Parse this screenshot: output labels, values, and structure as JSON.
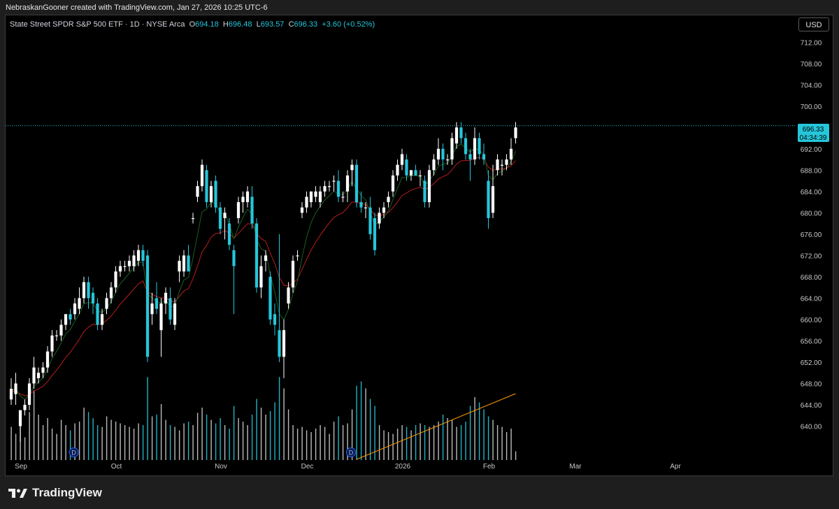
{
  "header": {
    "title": "NebraskanGooner created with TradingView.com, Jan 27, 2026 10:25 UTC-6"
  },
  "legend": {
    "symbol": "State Street SPDR S&P 500 ETF · 1D · NYSE Arca",
    "o_label": "O",
    "open": "694.18",
    "h_label": "H",
    "high": "696.48",
    "l_label": "L",
    "low": "693.57",
    "c_label": "C",
    "close": "696.33",
    "change": "+3.60 (+0.52%)"
  },
  "currency_button": "USD",
  "price_label": {
    "price": "696.33",
    "countdown": "04:34:39"
  },
  "footer": {
    "brand": "TradingView"
  },
  "colors": {
    "up": "#ffffff",
    "down": "#26c6da",
    "ema_short": "#1b5e20",
    "ema_long": "#b71c1c",
    "volume_ma": "#ff9800",
    "last_price_line": "#26c6da"
  },
  "chart_data": {
    "type": "candlestick",
    "ylim": [
      636,
      714
    ],
    "y_ticks": [
      "712.00",
      "708.00",
      "704.00",
      "700.00",
      "696.00",
      "692.00",
      "688.00",
      "684.00",
      "680.00",
      "676.00",
      "672.00",
      "668.00",
      "664.00",
      "660.00",
      "656.00",
      "652.00",
      "648.00",
      "644.00",
      "640.00"
    ],
    "x_ticks": [
      {
        "label": "Sep",
        "bar": 0
      },
      {
        "label": "Oct",
        "bar": 21
      },
      {
        "label": "Nov",
        "bar": 44
      },
      {
        "label": "Dec",
        "bar": 63
      },
      {
        "label": "2026",
        "bar": 84
      },
      {
        "label": "Feb",
        "bar": 103
      },
      {
        "label": "Mar",
        "bar": 122
      },
      {
        "label": "Apr",
        "bar": 144
      }
    ],
    "dividend_markers": [
      {
        "label": "D",
        "bar": 15
      },
      {
        "label": "D",
        "bar": 76
      }
    ],
    "last_price": 696.33,
    "candles": [
      {
        "o": 645,
        "h": 649,
        "l": 644,
        "c": 647
      },
      {
        "o": 646,
        "h": 650,
        "l": 644,
        "c": 648
      },
      {
        "o": 640,
        "h": 643,
        "l": 637,
        "c": 643
      },
      {
        "o": 643,
        "h": 645,
        "l": 642,
        "c": 644
      },
      {
        "o": 644,
        "h": 649,
        "l": 643,
        "c": 648
      },
      {
        "o": 648,
        "h": 653,
        "l": 647,
        "c": 651
      },
      {
        "o": 649,
        "h": 651,
        "l": 648,
        "c": 650
      },
      {
        "o": 650,
        "h": 652,
        "l": 649,
        "c": 651
      },
      {
        "o": 651,
        "h": 655,
        "l": 650,
        "c": 654
      },
      {
        "o": 654,
        "h": 658,
        "l": 653,
        "c": 657
      },
      {
        "o": 657,
        "h": 658,
        "l": 656,
        "c": 657
      },
      {
        "o": 657,
        "h": 660,
        "l": 656,
        "c": 659
      },
      {
        "o": 659,
        "h": 661,
        "l": 658,
        "c": 661
      },
      {
        "o": 661,
        "h": 662,
        "l": 659,
        "c": 660
      },
      {
        "o": 661,
        "h": 664,
        "l": 660,
        "c": 663
      },
      {
        "o": 662,
        "h": 666,
        "l": 661,
        "c": 664
      },
      {
        "o": 664,
        "h": 668,
        "l": 663,
        "c": 667
      },
      {
        "o": 667,
        "h": 668,
        "l": 662,
        "c": 664
      },
      {
        "o": 665,
        "h": 666,
        "l": 661,
        "c": 663
      },
      {
        "o": 663,
        "h": 664,
        "l": 658,
        "c": 659
      },
      {
        "o": 659,
        "h": 662,
        "l": 658,
        "c": 661
      },
      {
        "o": 662,
        "h": 665,
        "l": 661,
        "c": 664
      },
      {
        "o": 664,
        "h": 667,
        "l": 663,
        "c": 666
      },
      {
        "o": 666,
        "h": 670,
        "l": 665,
        "c": 669
      },
      {
        "o": 669,
        "h": 671,
        "l": 668,
        "c": 670
      },
      {
        "o": 670,
        "h": 671,
        "l": 669,
        "c": 670
      },
      {
        "o": 670,
        "h": 672,
        "l": 669,
        "c": 671
      },
      {
        "o": 670,
        "h": 673,
        "l": 669,
        "c": 672
      },
      {
        "o": 671,
        "h": 674,
        "l": 670,
        "c": 673
      },
      {
        "o": 673,
        "h": 674,
        "l": 670,
        "c": 671
      },
      {
        "o": 672,
        "h": 673,
        "l": 652,
        "c": 653
      },
      {
        "o": 661,
        "h": 665,
        "l": 659,
        "c": 663
      },
      {
        "o": 664,
        "h": 667,
        "l": 661,
        "c": 662
      },
      {
        "o": 658,
        "h": 664,
        "l": 653,
        "c": 663
      },
      {
        "o": 663,
        "h": 666,
        "l": 661,
        "c": 665
      },
      {
        "o": 664,
        "h": 666,
        "l": 659,
        "c": 660
      },
      {
        "o": 659,
        "h": 664,
        "l": 658,
        "c": 663
      },
      {
        "o": 669,
        "h": 672,
        "l": 667,
        "c": 671
      },
      {
        "o": 669,
        "h": 673,
        "l": 668,
        "c": 672
      },
      {
        "o": 672,
        "h": 674,
        "l": 669,
        "c": 669
      },
      {
        "o": 679,
        "h": 680,
        "l": 678,
        "c": 679
      },
      {
        "o": 683,
        "h": 686,
        "l": 682,
        "c": 685
      },
      {
        "o": 685,
        "h": 690,
        "l": 684,
        "c": 689
      },
      {
        "o": 688,
        "h": 689,
        "l": 681,
        "c": 682
      },
      {
        "o": 682,
        "h": 686,
        "l": 681,
        "c": 685
      },
      {
        "o": 686,
        "h": 687,
        "l": 680,
        "c": 681
      },
      {
        "o": 681,
        "h": 682,
        "l": 676,
        "c": 677
      },
      {
        "o": 679,
        "h": 681,
        "l": 675,
        "c": 680
      },
      {
        "o": 678,
        "h": 679,
        "l": 673,
        "c": 674
      },
      {
        "o": 673,
        "h": 674,
        "l": 661,
        "c": 670
      },
      {
        "o": 679,
        "h": 683,
        "l": 678,
        "c": 682
      },
      {
        "o": 682,
        "h": 684,
        "l": 680,
        "c": 683
      },
      {
        "o": 682,
        "h": 685,
        "l": 681,
        "c": 684
      },
      {
        "o": 683,
        "h": 685,
        "l": 677,
        "c": 678
      },
      {
        "o": 678,
        "h": 679,
        "l": 665,
        "c": 666
      },
      {
        "o": 666,
        "h": 672,
        "l": 664,
        "c": 670
      },
      {
        "o": 671,
        "h": 673,
        "l": 669,
        "c": 672
      },
      {
        "o": 668,
        "h": 669,
        "l": 659,
        "c": 660
      },
      {
        "o": 661,
        "h": 663,
        "l": 657,
        "c": 659
      },
      {
        "o": 658,
        "h": 676,
        "l": 652,
        "c": 653
      },
      {
        "o": 653,
        "h": 660,
        "l": 649,
        "c": 658
      },
      {
        "o": 663,
        "h": 667,
        "l": 662,
        "c": 666
      },
      {
        "o": 666,
        "h": 672,
        "l": 665,
        "c": 671
      },
      {
        "o": 672,
        "h": 673,
        "l": 671,
        "c": 672
      },
      {
        "o": 680,
        "h": 682,
        "l": 679,
        "c": 681
      },
      {
        "o": 681,
        "h": 684,
        "l": 680,
        "c": 683
      },
      {
        "o": 682,
        "h": 684,
        "l": 681,
        "c": 684
      },
      {
        "o": 683,
        "h": 685,
        "l": 682,
        "c": 684
      },
      {
        "o": 682,
        "h": 685,
        "l": 681,
        "c": 684
      },
      {
        "o": 684,
        "h": 686,
        "l": 683,
        "c": 685
      },
      {
        "o": 685,
        "h": 686,
        "l": 684,
        "c": 685
      },
      {
        "o": 686,
        "h": 687,
        "l": 684,
        "c": 686
      },
      {
        "o": 686,
        "h": 688,
        "l": 682,
        "c": 683
      },
      {
        "o": 683,
        "h": 684,
        "l": 682,
        "c": 683
      },
      {
        "o": 684,
        "h": 688,
        "l": 682,
        "c": 687
      },
      {
        "o": 688,
        "h": 690,
        "l": 685,
        "c": 689
      },
      {
        "o": 689,
        "h": 690,
        "l": 681,
        "c": 682
      },
      {
        "o": 682,
        "h": 684,
        "l": 680,
        "c": 681
      },
      {
        "o": 681,
        "h": 682,
        "l": 679,
        "c": 681
      },
      {
        "o": 681,
        "h": 683,
        "l": 675,
        "c": 676
      },
      {
        "o": 679,
        "h": 680,
        "l": 672,
        "c": 673
      },
      {
        "o": 678,
        "h": 681,
        "l": 677,
        "c": 680
      },
      {
        "o": 680,
        "h": 682,
        "l": 679,
        "c": 681
      },
      {
        "o": 682,
        "h": 684,
        "l": 681,
        "c": 683
      },
      {
        "o": 684,
        "h": 688,
        "l": 683,
        "c": 687
      },
      {
        "o": 687,
        "h": 690,
        "l": 686,
        "c": 689
      },
      {
        "o": 689,
        "h": 692,
        "l": 688,
        "c": 691
      },
      {
        "o": 690,
        "h": 691,
        "l": 686,
        "c": 687
      },
      {
        "o": 687,
        "h": 688,
        "l": 686,
        "c": 688
      },
      {
        "o": 688,
        "h": 689,
        "l": 687,
        "c": 687
      },
      {
        "o": 687,
        "h": 688,
        "l": 685,
        "c": 687
      },
      {
        "o": 686,
        "h": 687,
        "l": 681,
        "c": 682
      },
      {
        "o": 682,
        "h": 689,
        "l": 681,
        "c": 688
      },
      {
        "o": 688,
        "h": 691,
        "l": 687,
        "c": 690
      },
      {
        "o": 690,
        "h": 694,
        "l": 689,
        "c": 692
      },
      {
        "o": 692,
        "h": 693,
        "l": 688,
        "c": 690
      },
      {
        "o": 690,
        "h": 691,
        "l": 689,
        "c": 690
      },
      {
        "o": 690,
        "h": 695,
        "l": 689,
        "c": 694
      },
      {
        "o": 693,
        "h": 697,
        "l": 692,
        "c": 696
      },
      {
        "o": 696,
        "h": 697,
        "l": 693,
        "c": 694
      },
      {
        "o": 694,
        "h": 695,
        "l": 690,
        "c": 691
      },
      {
        "o": 691,
        "h": 692,
        "l": 686,
        "c": 690
      },
      {
        "o": 690,
        "h": 696,
        "l": 689,
        "c": 694
      },
      {
        "o": 694,
        "h": 695,
        "l": 690,
        "c": 691
      },
      {
        "o": 691,
        "h": 693,
        "l": 689,
        "c": 690
      },
      {
        "o": 686,
        "h": 688,
        "l": 677,
        "c": 679
      },
      {
        "o": 680,
        "h": 689,
        "l": 679,
        "c": 685
      },
      {
        "o": 688,
        "h": 691,
        "l": 687,
        "c": 690
      },
      {
        "o": 689,
        "h": 690,
        "l": 687,
        "c": 689
      },
      {
        "o": 689,
        "h": 691,
        "l": 688,
        "c": 690
      },
      {
        "o": 690,
        "h": 694,
        "l": 689,
        "c": 692
      },
      {
        "o": 694,
        "h": 697,
        "l": 693,
        "c": 696
      }
    ],
    "volumes": [
      0.38,
      0.3,
      0.42,
      0.26,
      0.55,
      0.8,
      0.52,
      0.4,
      0.48,
      0.36,
      0.3,
      0.46,
      0.4,
      0.34,
      0.42,
      0.44,
      0.6,
      0.55,
      0.48,
      0.4,
      0.38,
      0.5,
      0.46,
      0.44,
      0.42,
      0.4,
      0.38,
      0.36,
      0.42,
      0.4,
      0.95,
      0.5,
      0.52,
      0.64,
      0.46,
      0.4,
      0.38,
      0.34,
      0.42,
      0.44,
      0.4,
      0.54,
      0.6,
      0.52,
      0.46,
      0.42,
      0.48,
      0.4,
      0.36,
      0.62,
      0.48,
      0.44,
      0.4,
      0.52,
      0.7,
      0.6,
      0.52,
      0.56,
      0.66,
      0.95,
      0.82,
      0.58,
      0.4,
      0.36,
      0.38,
      0.34,
      0.32,
      0.36,
      0.4,
      0.38,
      0.3,
      0.44,
      0.5,
      0.4,
      0.42,
      0.58,
      0.85,
      0.9,
      0.82,
      0.7,
      0.62,
      0.4,
      0.34,
      0.32,
      0.3,
      0.36,
      0.4,
      0.38,
      0.34,
      0.4,
      0.42,
      0.4,
      0.38,
      0.4,
      0.44,
      0.52,
      0.48,
      0.46,
      0.38,
      0.4,
      0.44,
      0.62,
      0.72,
      0.66,
      0.58,
      0.5,
      0.46,
      0.4,
      0.38,
      0.32,
      0.36,
      0.1
    ],
    "ema_short": "computed from closes (period 5)",
    "ema_long": "computed from closes (period 13)"
  }
}
